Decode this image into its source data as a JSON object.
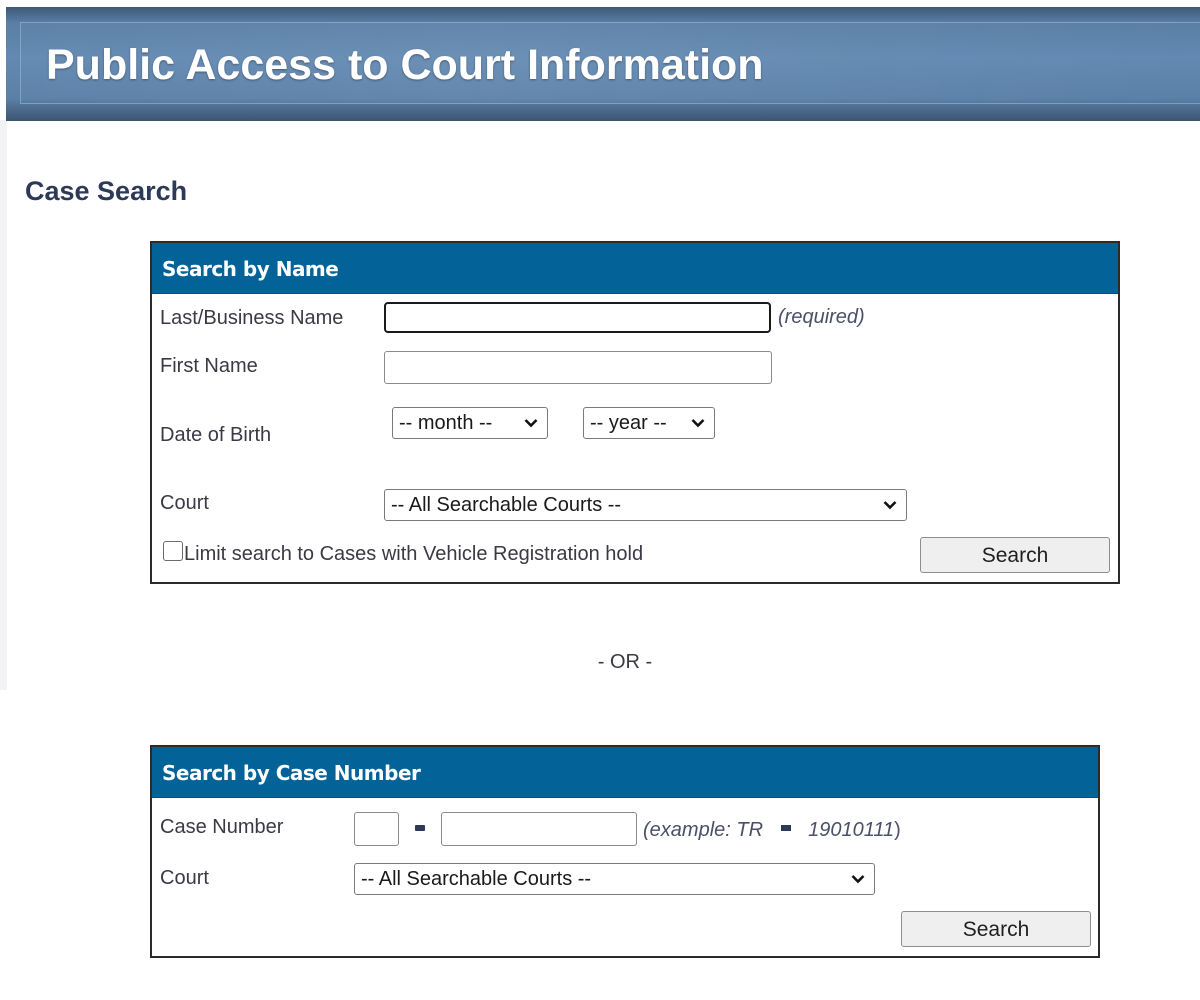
{
  "header": {
    "title": "Public Access to Court Information"
  },
  "page": {
    "heading": "Case Search",
    "separator": "- OR -"
  },
  "search_by_name": {
    "title": "Search by Name",
    "last_name": {
      "label": "Last/Business Name",
      "value": "",
      "hint": "(required)"
    },
    "first_name": {
      "label": "First Name",
      "value": ""
    },
    "dob": {
      "label": "Date of Birth",
      "month_selected": "-- month --",
      "year_selected": "-- year --"
    },
    "court": {
      "label": "Court",
      "selected": "-- All Searchable Courts --"
    },
    "vehicle_hold": {
      "label": "Limit search to Cases with Vehicle Registration hold",
      "checked": false
    },
    "search_button": "Search"
  },
  "search_by_case": {
    "title": "Search by Case Number",
    "case_number": {
      "label": "Case Number",
      "prefix_value": "",
      "number_value": "",
      "hint_prefix": "(example: TR",
      "hint_number": "19010111",
      "hint_close": ")"
    },
    "court": {
      "label": "Court",
      "selected": "-- All Searchable Courts --"
    },
    "search_button": "Search"
  },
  "colors": {
    "panel_header": "#036399",
    "banner": "#5b80a8",
    "heading_text": "#2d3a57"
  }
}
